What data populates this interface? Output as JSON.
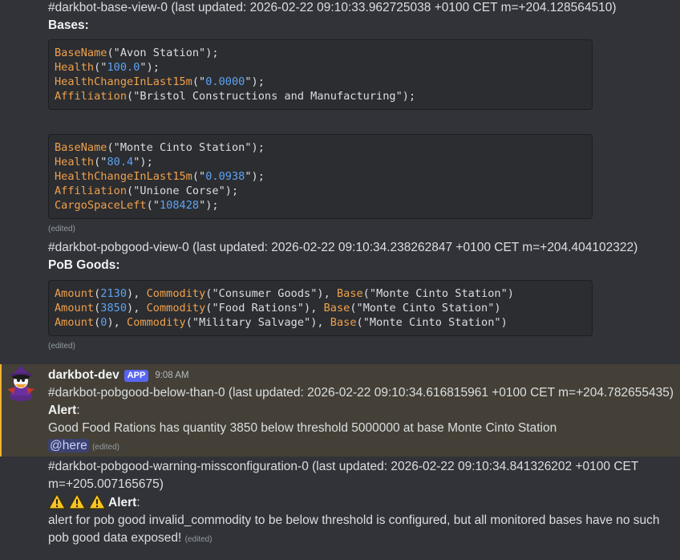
{
  "msg1": {
    "title": "#darkbot-base-view-0 (last updated: 2026-02-22 09:10:33.962725038 +0100 CET m=+204.128564510)",
    "heading": "Bases:",
    "code1": [
      [
        {
          "t": "BaseName",
          "c": "fn"
        },
        {
          "t": "(\"Avon Station\");",
          "c": "str"
        }
      ],
      [
        {
          "t": "Health",
          "c": "fn"
        },
        {
          "t": "(\"",
          "c": "str"
        },
        {
          "t": "100.0",
          "c": "num"
        },
        {
          "t": "\");",
          "c": "str"
        }
      ],
      [
        {
          "t": "HealthChangeInLast15m",
          "c": "fn"
        },
        {
          "t": "(\"",
          "c": "str"
        },
        {
          "t": "0.0000",
          "c": "num"
        },
        {
          "t": "\");",
          "c": "str"
        }
      ],
      [
        {
          "t": "Affiliation",
          "c": "fn"
        },
        {
          "t": "(\"Bristol Constructions and Manufacturing\");",
          "c": "str"
        }
      ]
    ],
    "code2": [
      [
        {
          "t": "BaseName",
          "c": "fn"
        },
        {
          "t": "(\"Monte Cinto Station\");",
          "c": "str"
        }
      ],
      [
        {
          "t": "Health",
          "c": "fn"
        },
        {
          "t": "(\"",
          "c": "str"
        },
        {
          "t": "80.4",
          "c": "num"
        },
        {
          "t": "\");",
          "c": "str"
        }
      ],
      [
        {
          "t": "HealthChangeInLast15m",
          "c": "fn"
        },
        {
          "t": "(\"",
          "c": "str"
        },
        {
          "t": "0.0938",
          "c": "num"
        },
        {
          "t": "\");",
          "c": "str"
        }
      ],
      [
        {
          "t": "Affiliation",
          "c": "fn"
        },
        {
          "t": "(\"Unione Corse\");",
          "c": "str"
        }
      ],
      [
        {
          "t": "CargoSpaceLeft",
          "c": "fn"
        },
        {
          "t": "(\"",
          "c": "str"
        },
        {
          "t": "108428",
          "c": "num"
        },
        {
          "t": "\");",
          "c": "str"
        }
      ]
    ],
    "edited": "(edited)"
  },
  "msg2": {
    "title": "#darkbot-pobgood-view-0 (last updated: 2026-02-22 09:10:34.238262847 +0100 CET m=+204.404102322)",
    "heading": "PoB Goods:",
    "code": [
      [
        {
          "t": "Amount",
          "c": "fn"
        },
        {
          "t": "(",
          "c": "str"
        },
        {
          "t": "2130",
          "c": "num"
        },
        {
          "t": "), ",
          "c": "str"
        },
        {
          "t": "Commodity",
          "c": "fn"
        },
        {
          "t": "(\"Consumer Goods\"), ",
          "c": "str"
        },
        {
          "t": "Base",
          "c": "fn"
        },
        {
          "t": "(\"Monte Cinto Station\")",
          "c": "str"
        }
      ],
      [
        {
          "t": "Amount",
          "c": "fn"
        },
        {
          "t": "(",
          "c": "str"
        },
        {
          "t": "3850",
          "c": "num"
        },
        {
          "t": "), ",
          "c": "str"
        },
        {
          "t": "Commodity",
          "c": "fn"
        },
        {
          "t": "(\"Food Rations\"), ",
          "c": "str"
        },
        {
          "t": "Base",
          "c": "fn"
        },
        {
          "t": "(\"Monte Cinto Station\")",
          "c": "str"
        }
      ],
      [
        {
          "t": "Amount",
          "c": "fn"
        },
        {
          "t": "(",
          "c": "str"
        },
        {
          "t": "0",
          "c": "num"
        },
        {
          "t": "), ",
          "c": "str"
        },
        {
          "t": "Commodity",
          "c": "fn"
        },
        {
          "t": "(\"Military Salvage\"), ",
          "c": "str"
        },
        {
          "t": "Base",
          "c": "fn"
        },
        {
          "t": "(\"Monte Cinto Station\")",
          "c": "str"
        }
      ]
    ],
    "edited": "(edited)"
  },
  "msg3": {
    "username": "darkbot-dev",
    "badge": "APP",
    "timestamp": "9:08 AM",
    "title": "#darkbot-pobgood-below-than-0 (last updated: 2026-02-22 09:10:34.616815961 +0100 CET m=+204.782655435)",
    "alert_label": "Alert",
    "alert_colon": ":",
    "body": "Good Food Rations has quantity 3850 below threshold 5000000 at base Monte Cinto Station",
    "mention": "@here",
    "edited": "(edited)"
  },
  "msg4": {
    "title": "#darkbot-pobgood-warning-missconfiguration-0 (last updated: 2026-02-22 09:10:34.841326202 +0100 CET m=+205.007165675)",
    "alert_label": "Alert",
    "alert_colon": ":",
    "body": "alert for pob good invalid_commodity to be below threshold is configured, but all monitored bases have no such pob good data exposed!",
    "edited": "(edited)"
  },
  "icons": {
    "warning": "warning-icon",
    "avatar": "duck-avatar"
  },
  "colors": {
    "function": "#f0a04b",
    "number": "#5ea3f2",
    "mention_bg": "#3c4270",
    "highlight_bg": "#444037",
    "highlight_bar": "#f0b232",
    "app_badge": "#5865f2"
  }
}
